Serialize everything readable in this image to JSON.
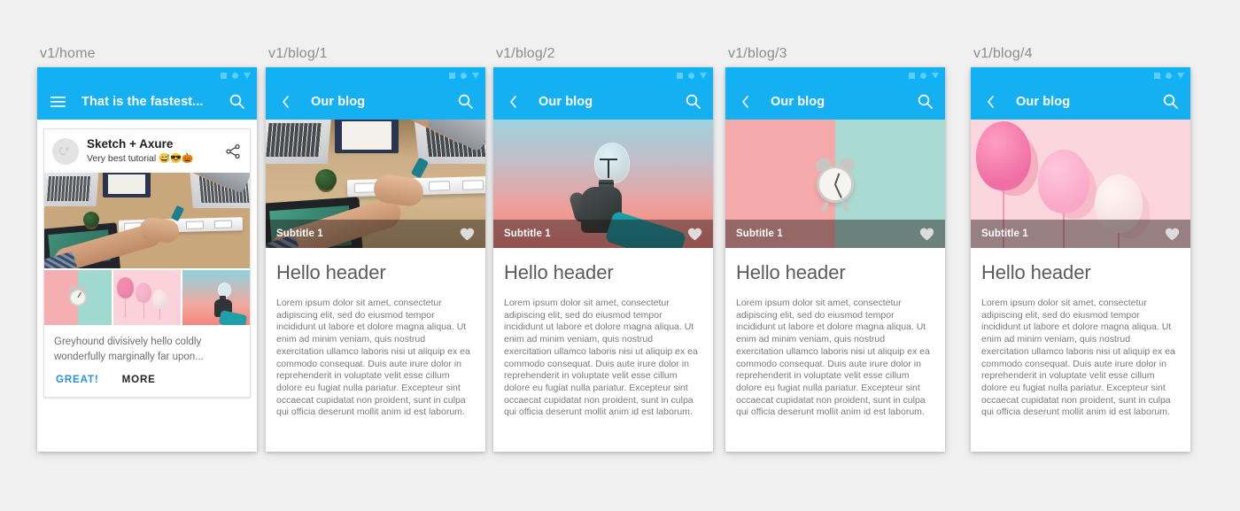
{
  "background_color": "#f0f0f0",
  "accent_color": "#15b0f2",
  "statusbar_color": "#10b2f5",
  "statusbar_icon_color": "#5fcdfb",
  "screens": [
    {
      "label": "v1/home",
      "type": "home",
      "appbar": {
        "title": "That is the fastest...",
        "leading_icon": "hamburger-menu-icon",
        "trailing_icon": "search-icon"
      },
      "statusbar": {
        "icons": [
          "square-icon",
          "circle-icon",
          "triangle-down-icon"
        ]
      },
      "card": {
        "avatar_icon": "avatar-placeholder-icon",
        "title": "Sketch + Axure",
        "subtitle": "Very best tutorial 😅😎🎃",
        "share_icon": "share-icon",
        "hero_photo": "desk-handshake-photo",
        "thumbnails": [
          {
            "name": "alarm-clock-thumbnail"
          },
          {
            "name": "pink-balloons-thumbnail"
          },
          {
            "name": "lightbulb-sunset-thumbnail"
          }
        ],
        "body": "Greyhound divisively hello coldly wonderfully marginally far upon...",
        "actions": {
          "primary": "GREAT!",
          "secondary": "MORE",
          "primary_color": "#2a8fd4",
          "secondary_color": "#252525"
        }
      }
    },
    {
      "label": "v1/blog/1",
      "type": "blog",
      "appbar": {
        "title": "Our blog",
        "leading_icon": "back-chevron-icon",
        "trailing_icon": "search-icon"
      },
      "statusbar": {
        "icons": [
          "square-icon",
          "circle-icon",
          "triangle-down-icon"
        ]
      },
      "hero": {
        "scene": "desk-handshake-photo",
        "subtitle": "Subtitle 1",
        "favorite_icon": "heart-icon"
      },
      "heading": "Hello header",
      "paragraph": "Lorem ipsum dolor sit amet, consectetur adipiscing elit, sed do eiusmod tempor incididunt ut labore et dolore magna aliqua. Ut enim ad minim veniam, quis nostrud exercitation ullamco laboris nisi ut aliquip ex ea commodo consequat. Duis aute irure dolor in reprehenderit in voluptate velit esse cillum dolore eu fugiat nulla pariatur. Excepteur sint occaecat cupidatat non proident, sunt in culpa qui officia deserunt mollit anim id est laborum."
    },
    {
      "label": "v1/blog/2",
      "type": "blog",
      "appbar": {
        "title": "Our blog",
        "leading_icon": "back-chevron-icon",
        "trailing_icon": "search-icon"
      },
      "statusbar": {
        "icons": [
          "square-icon",
          "circle-icon",
          "triangle-down-icon"
        ]
      },
      "hero": {
        "scene": "lightbulb-sunset-photo",
        "subtitle": "Subtitle 1",
        "favorite_icon": "heart-icon"
      },
      "heading": "Hello header",
      "paragraph": "Lorem ipsum dolor sit amet, consectetur adipiscing elit, sed do eiusmod tempor incididunt ut labore et dolore magna aliqua. Ut enim ad minim veniam, quis nostrud exercitation ullamco laboris nisi ut aliquip ex ea commodo consequat. Duis aute irure dolor in reprehenderit in voluptate velit esse cillum dolore eu fugiat nulla pariatur. Excepteur sint occaecat cupidatat non proident, sunt in culpa qui officia deserunt mollit anim id est laborum."
    },
    {
      "label": "v1/blog/3",
      "type": "blog",
      "appbar": {
        "title": "Our blog",
        "leading_icon": "back-chevron-icon",
        "trailing_icon": "search-icon"
      },
      "statusbar": {
        "icons": [
          "square-icon",
          "circle-icon",
          "triangle-down-icon"
        ]
      },
      "hero": {
        "scene": "alarm-clock-photo",
        "subtitle": "Subtitle 1",
        "favorite_icon": "heart-icon"
      },
      "heading": "Hello header",
      "paragraph": "Lorem ipsum dolor sit amet, consectetur adipiscing elit, sed do eiusmod tempor incididunt ut labore et dolore magna aliqua. Ut enim ad minim veniam, quis nostrud exercitation ullamco laboris nisi ut aliquip ex ea commodo consequat. Duis aute irure dolor in reprehenderit in voluptate velit esse cillum dolore eu fugiat nulla pariatur. Excepteur sint occaecat cupidatat non proident, sunt in culpa qui officia deserunt mollit anim id est laborum."
    },
    {
      "label": "v1/blog/4",
      "type": "blog",
      "appbar": {
        "title": "Our blog",
        "leading_icon": "back-chevron-icon",
        "trailing_icon": "search-icon"
      },
      "statusbar": {
        "icons": [
          "square-icon",
          "circle-icon",
          "triangle-down-icon"
        ]
      },
      "hero": {
        "scene": "pink-balloons-photo",
        "subtitle": "Subtitle 1",
        "favorite_icon": "heart-icon"
      },
      "heading": "Hello header",
      "paragraph": "Lorem ipsum dolor sit amet, consectetur adipiscing elit, sed do eiusmod tempor incididunt ut labore et dolore magna aliqua. Ut enim ad minim veniam, quis nostrud exercitation ullamco laboris nisi ut aliquip ex ea commodo consequat. Duis aute irure dolor in reprehenderit in voluptate velit esse cillum dolore eu fugiat nulla pariatur. Excepteur sint occaecat cupidatat non proident, sunt in culpa qui officia deserunt mollit anim id est laborum."
    }
  ]
}
